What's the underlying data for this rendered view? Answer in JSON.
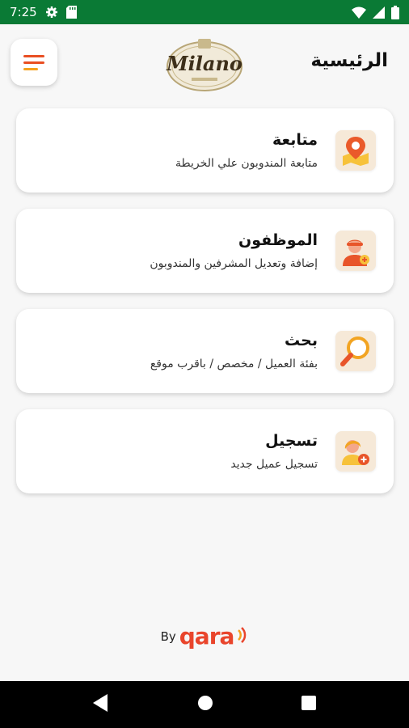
{
  "status_bar": {
    "time": "7:25"
  },
  "header": {
    "title": "الرئيسية",
    "logo_text": "Milano"
  },
  "cards": [
    {
      "title": "متابعة",
      "subtitle": "متابعة المندوبون علي الخريطة",
      "icon": "map-pin-icon"
    },
    {
      "title": "الموظفون",
      "subtitle": "إضافة وتعديل المشرفين والمندوبون",
      "icon": "add-employee-icon"
    },
    {
      "title": "بحث",
      "subtitle": "بفئة العميل / مخصص / باقرب موقع",
      "icon": "magnifier-icon"
    },
    {
      "title": "تسجيل",
      "subtitle": "تسجيل عميل جديد",
      "icon": "add-client-icon"
    }
  ],
  "footer": {
    "by": "By",
    "brand": "qara"
  },
  "colors": {
    "status_bar": "#0a7a35",
    "accent": "#e94f23",
    "accent_secondary": "#f6a21e",
    "icon_bg": "#f6e9d8"
  }
}
